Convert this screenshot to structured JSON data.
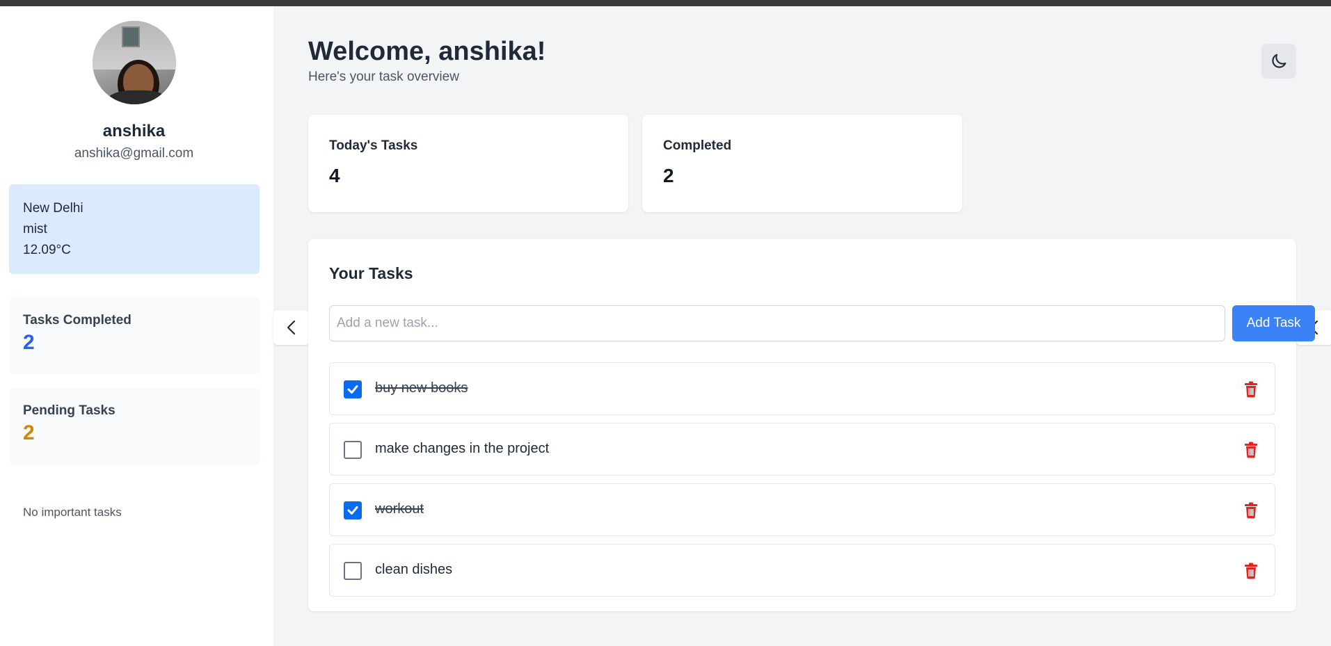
{
  "sidebar": {
    "username": "anshika",
    "email": "anshika@gmail.com",
    "weather": {
      "city": "New Delhi",
      "condition": "mist",
      "temperature": "12.09°C"
    },
    "tasks_completed": {
      "label": "Tasks Completed",
      "value": "2",
      "color": "#2563eb"
    },
    "pending_tasks": {
      "label": "Pending Tasks",
      "value": "2",
      "color": "#ca8a04"
    },
    "important_note": "No important tasks"
  },
  "header": {
    "title": "Welcome, anshika!",
    "subtitle": "Here's your task overview"
  },
  "summary": {
    "today": {
      "label": "Today's Tasks",
      "value": "4"
    },
    "completed": {
      "label": "Completed",
      "value": "2"
    }
  },
  "tasks_panel": {
    "title": "Your Tasks",
    "input_placeholder": "Add a new task...",
    "add_button_label": "Add Task",
    "tasks": [
      {
        "text": "buy new books",
        "done": true
      },
      {
        "text": "make changes in the project",
        "done": false
      },
      {
        "text": "workout",
        "done": true
      },
      {
        "text": "clean dishes",
        "done": false
      }
    ]
  },
  "colors": {
    "accent": "#3b82f6",
    "danger": "#dc2626",
    "weather_bg": "#dbeafe"
  },
  "icons": {
    "theme_toggle": "moon-icon",
    "delete": "trash-icon",
    "collapse": "chevron-left-icon"
  }
}
